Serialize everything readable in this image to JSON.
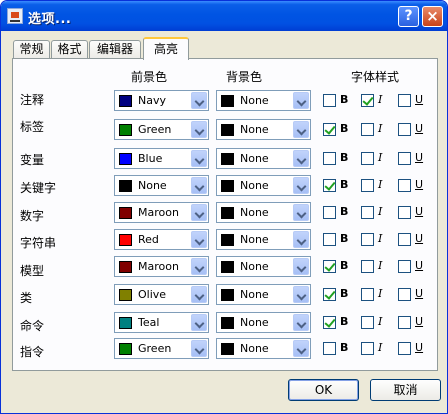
{
  "window": {
    "title": "选项..."
  },
  "title_buttons": {
    "help": "?",
    "close": "×"
  },
  "tabs": [
    {
      "label": "常规"
    },
    {
      "label": "格式"
    },
    {
      "label": "编辑器"
    },
    {
      "label": "高亮",
      "active": true
    }
  ],
  "columns": {
    "foreground": "前景色",
    "background": "背景色",
    "font_style": "字体样式"
  },
  "style_labels": {
    "bold": "B",
    "italic": "I",
    "underline": "U"
  },
  "rows": [
    {
      "label": "注释",
      "fg": "Navy",
      "fg_color": "#000080",
      "bg": "None",
      "bg_color": "#000000",
      "bold": false,
      "italic": true,
      "underline": false
    },
    {
      "label": "标签",
      "fg": "Green",
      "fg_color": "#008000",
      "bg": "None",
      "bg_color": "#000000",
      "bold": true,
      "italic": false,
      "underline": false
    },
    {
      "label": "变量",
      "fg": "Blue",
      "fg_color": "#0000ff",
      "bg": "None",
      "bg_color": "#000000",
      "bold": false,
      "italic": false,
      "underline": false
    },
    {
      "label": "关键字",
      "fg": "None",
      "fg_color": "#000000",
      "bg": "None",
      "bg_color": "#000000",
      "bold": true,
      "italic": false,
      "underline": false
    },
    {
      "label": "数字",
      "fg": "Maroon",
      "fg_color": "#800000",
      "bg": "None",
      "bg_color": "#000000",
      "bold": false,
      "italic": false,
      "underline": false
    },
    {
      "label": "字符串",
      "fg": "Red",
      "fg_color": "#ff0000",
      "bg": "None",
      "bg_color": "#000000",
      "bold": false,
      "italic": false,
      "underline": false
    },
    {
      "label": "模型",
      "fg": "Maroon",
      "fg_color": "#800000",
      "bg": "None",
      "bg_color": "#000000",
      "bold": true,
      "italic": false,
      "underline": false
    },
    {
      "label": "类",
      "fg": "Olive",
      "fg_color": "#808000",
      "bg": "None",
      "bg_color": "#000000",
      "bold": true,
      "italic": false,
      "underline": false
    },
    {
      "label": "命令",
      "fg": "Teal",
      "fg_color": "#008080",
      "bg": "None",
      "bg_color": "#000000",
      "bold": true,
      "italic": false,
      "underline": false
    },
    {
      "label": "指令",
      "fg": "Green",
      "fg_color": "#008000",
      "bg": "None",
      "bg_color": "#000000",
      "bold": false,
      "italic": false,
      "underline": false
    }
  ],
  "buttons": {
    "ok": "OK",
    "cancel": "取消"
  }
}
